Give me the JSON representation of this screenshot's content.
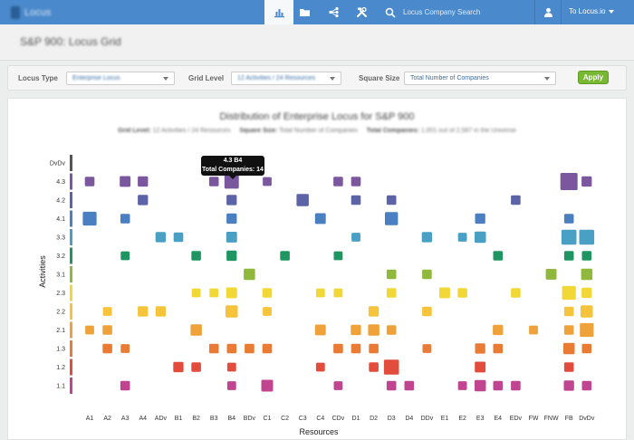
{
  "nav": {
    "logo_text": "Locus",
    "search_placeholder": "Locus Company Search",
    "user_link": "To Locus.io"
  },
  "page": {
    "title": "S&P 900: Locus Grid"
  },
  "controls": {
    "locus_type_label": "Locus Type",
    "locus_type_value": "Enterprise Locus",
    "grid_level_label": "Grid Level",
    "grid_level_value": "12 Activities / 24 Resources",
    "square_size_label": "Square Size",
    "square_size_value": "Total Number of Companies",
    "apply_label": "Apply"
  },
  "chart_header": {
    "title": "Distribution of Enterprise Locus for S&P 900",
    "subtitle_parts": [
      {
        "label": "Grid Level:",
        "value": "12 Activities / 24 Resources"
      },
      {
        "label": "Square Size:",
        "value": "Total Number of Companies"
      },
      {
        "label": "Total Companies:",
        "value": "1,001 out of 2,587 in the Universe"
      }
    ]
  },
  "tooltip": {
    "line1": "4.3 B4",
    "line2": "Total Companies: 14"
  },
  "chart_data": {
    "type": "scatter",
    "xlabel": "Resources",
    "ylabel": "Activities",
    "categories": [
      "A1",
      "A2",
      "A3",
      "A4",
      "ADv",
      "B1",
      "B2",
      "B3",
      "B4",
      "BDv",
      "C1",
      "C2",
      "C3",
      "C4",
      "CDv",
      "D1",
      "D2",
      "D3",
      "D4",
      "DDv",
      "E1",
      "E2",
      "E3",
      "E4",
      "EDv",
      "FW",
      "FNW",
      "FB",
      "DvDv"
    ],
    "rows": [
      {
        "label": "DvDv",
        "color": "#555555"
      },
      {
        "label": "4.3",
        "color": "#7b579e"
      },
      {
        "label": "4.2",
        "color": "#5c63a6"
      },
      {
        "label": "4.1",
        "color": "#4a7fc1"
      },
      {
        "label": "3.3",
        "color": "#4a9fc4"
      },
      {
        "label": "3.2",
        "color": "#1f9661"
      },
      {
        "label": "3.1",
        "color": "#8fb83c"
      },
      {
        "label": "2.3",
        "color": "#f2d836"
      },
      {
        "label": "2.2",
        "color": "#f5c43a"
      },
      {
        "label": "2.1",
        "color": "#f0a23a"
      },
      {
        "label": "1.3",
        "color": "#e97b35"
      },
      {
        "label": "1.2",
        "color": "#e34b3d"
      },
      {
        "label": "1.1",
        "color": "#c0448f"
      }
    ],
    "points": [
      {
        "row": "4.3",
        "col": "A1",
        "value": 3
      },
      {
        "row": "4.3",
        "col": "A3",
        "value": 5
      },
      {
        "row": "4.3",
        "col": "A4",
        "value": 4
      },
      {
        "row": "4.3",
        "col": "B3",
        "value": 3
      },
      {
        "row": "4.3",
        "col": "B4",
        "value": 14
      },
      {
        "row": "4.3",
        "col": "C1",
        "value": 2
      },
      {
        "row": "4.3",
        "col": "CDv",
        "value": 3
      },
      {
        "row": "4.3",
        "col": "D1",
        "value": 3
      },
      {
        "row": "4.3",
        "col": "FB",
        "value": 24
      },
      {
        "row": "4.3",
        "col": "DvDv",
        "value": 4
      },
      {
        "row": "4.2",
        "col": "A4",
        "value": 4
      },
      {
        "row": "4.2",
        "col": "B4",
        "value": 4
      },
      {
        "row": "4.2",
        "col": "C3",
        "value": 8
      },
      {
        "row": "4.2",
        "col": "D1",
        "value": 3
      },
      {
        "row": "4.2",
        "col": "D3",
        "value": 3
      },
      {
        "row": "4.2",
        "col": "EDv",
        "value": 3
      },
      {
        "row": "4.1",
        "col": "A1",
        "value": 12
      },
      {
        "row": "4.1",
        "col": "A3",
        "value": 3
      },
      {
        "row": "4.1",
        "col": "B4",
        "value": 4
      },
      {
        "row": "4.1",
        "col": "C4",
        "value": 5
      },
      {
        "row": "4.1",
        "col": "D3",
        "value": 10
      },
      {
        "row": "4.1",
        "col": "E3",
        "value": 4
      },
      {
        "row": "4.1",
        "col": "FB",
        "value": 3
      },
      {
        "row": "3.3",
        "col": "ADv",
        "value": 4
      },
      {
        "row": "3.3",
        "col": "B1",
        "value": 3
      },
      {
        "row": "3.3",
        "col": "B4",
        "value": 5
      },
      {
        "row": "3.3",
        "col": "D1",
        "value": 2
      },
      {
        "row": "3.3",
        "col": "DDv",
        "value": 4
      },
      {
        "row": "3.3",
        "col": "E2",
        "value": 2
      },
      {
        "row": "3.3",
        "col": "E3",
        "value": 6
      },
      {
        "row": "3.3",
        "col": "FB",
        "value": 16
      },
      {
        "row": "3.3",
        "col": "DvDv",
        "value": 16
      },
      {
        "row": "3.2",
        "col": "A3",
        "value": 2
      },
      {
        "row": "3.2",
        "col": "B2",
        "value": 3
      },
      {
        "row": "3.2",
        "col": "B4",
        "value": 4
      },
      {
        "row": "3.2",
        "col": "C2",
        "value": 3
      },
      {
        "row": "3.2",
        "col": "CDv",
        "value": 2
      },
      {
        "row": "3.2",
        "col": "E4",
        "value": 3
      },
      {
        "row": "3.2",
        "col": "FB",
        "value": 3
      },
      {
        "row": "3.2",
        "col": "DvDv",
        "value": 3
      },
      {
        "row": "3.1",
        "col": "BDv",
        "value": 6
      },
      {
        "row": "3.1",
        "col": "D3",
        "value": 3
      },
      {
        "row": "3.1",
        "col": "DDv",
        "value": 3
      },
      {
        "row": "3.1",
        "col": "FNW",
        "value": 5
      },
      {
        "row": "3.1",
        "col": "DvDv",
        "value": 6
      },
      {
        "row": "2.3",
        "col": "B2",
        "value": 2
      },
      {
        "row": "2.3",
        "col": "B3",
        "value": 2
      },
      {
        "row": "2.3",
        "col": "B4",
        "value": 5
      },
      {
        "row": "2.3",
        "col": "C1",
        "value": 3
      },
      {
        "row": "2.3",
        "col": "C4",
        "value": 2
      },
      {
        "row": "2.3",
        "col": "CDv",
        "value": 2
      },
      {
        "row": "2.3",
        "col": "D3",
        "value": 3
      },
      {
        "row": "2.3",
        "col": "E1",
        "value": 5
      },
      {
        "row": "2.3",
        "col": "E2",
        "value": 3
      },
      {
        "row": "2.3",
        "col": "EDv",
        "value": 3
      },
      {
        "row": "2.3",
        "col": "FB",
        "value": 12
      },
      {
        "row": "2.3",
        "col": "DvDv",
        "value": 4
      },
      {
        "row": "2.2",
        "col": "A2",
        "value": 2
      },
      {
        "row": "2.2",
        "col": "A4",
        "value": 4
      },
      {
        "row": "2.2",
        "col": "ADv",
        "value": 4
      },
      {
        "row": "2.2",
        "col": "B4",
        "value": 8
      },
      {
        "row": "2.2",
        "col": "C1",
        "value": 2
      },
      {
        "row": "2.2",
        "col": "D2",
        "value": 4
      },
      {
        "row": "2.2",
        "col": "DDv",
        "value": 3
      },
      {
        "row": "2.2",
        "col": "FB",
        "value": 3
      },
      {
        "row": "2.2",
        "col": "DvDv",
        "value": 8
      },
      {
        "row": "2.1",
        "col": "A1",
        "value": 2
      },
      {
        "row": "2.1",
        "col": "A2",
        "value": 3
      },
      {
        "row": "2.1",
        "col": "B2",
        "value": 6
      },
      {
        "row": "2.1",
        "col": "C4",
        "value": 5
      },
      {
        "row": "2.1",
        "col": "D1",
        "value": 4
      },
      {
        "row": "2.1",
        "col": "D2",
        "value": 6
      },
      {
        "row": "2.1",
        "col": "D3",
        "value": 3
      },
      {
        "row": "2.1",
        "col": "E4",
        "value": 4
      },
      {
        "row": "2.1",
        "col": "FW",
        "value": 2
      },
      {
        "row": "2.1",
        "col": "FB",
        "value": 3
      },
      {
        "row": "2.1",
        "col": "DvDv",
        "value": 12
      },
      {
        "row": "1.3",
        "col": "A2",
        "value": 3
      },
      {
        "row": "1.3",
        "col": "A3",
        "value": 2
      },
      {
        "row": "1.3",
        "col": "B3",
        "value": 3
      },
      {
        "row": "1.3",
        "col": "B4",
        "value": 3
      },
      {
        "row": "1.3",
        "col": "BDv",
        "value": 3
      },
      {
        "row": "1.3",
        "col": "C1",
        "value": 3
      },
      {
        "row": "1.3",
        "col": "CDv",
        "value": 3
      },
      {
        "row": "1.3",
        "col": "D1",
        "value": 3
      },
      {
        "row": "1.3",
        "col": "D2",
        "value": 3
      },
      {
        "row": "1.3",
        "col": "DDv",
        "value": 2
      },
      {
        "row": "1.3",
        "col": "E3",
        "value": 4
      },
      {
        "row": "1.3",
        "col": "E4",
        "value": 3
      },
      {
        "row": "1.3",
        "col": "FB",
        "value": 6
      },
      {
        "row": "1.3",
        "col": "DvDv",
        "value": 3
      },
      {
        "row": "1.2",
        "col": "B1",
        "value": 4
      },
      {
        "row": "1.2",
        "col": "B2",
        "value": 3
      },
      {
        "row": "1.2",
        "col": "B4",
        "value": 2
      },
      {
        "row": "1.2",
        "col": "C4",
        "value": 2
      },
      {
        "row": "1.2",
        "col": "D2",
        "value": 3
      },
      {
        "row": "1.2",
        "col": "D3",
        "value": 16
      },
      {
        "row": "1.2",
        "col": "E3",
        "value": 5
      },
      {
        "row": "1.2",
        "col": "FB",
        "value": 3
      },
      {
        "row": "1.1",
        "col": "A3",
        "value": 3
      },
      {
        "row": "1.1",
        "col": "B4",
        "value": 2
      },
      {
        "row": "1.1",
        "col": "C1",
        "value": 7
      },
      {
        "row": "1.1",
        "col": "CDv",
        "value": 2
      },
      {
        "row": "1.1",
        "col": "D3",
        "value": 3
      },
      {
        "row": "1.1",
        "col": "D4",
        "value": 3
      },
      {
        "row": "1.1",
        "col": "E2",
        "value": 2
      },
      {
        "row": "1.1",
        "col": "E3",
        "value": 6
      },
      {
        "row": "1.1",
        "col": "E4",
        "value": 3
      },
      {
        "row": "1.1",
        "col": "EDv",
        "value": 3
      },
      {
        "row": "1.1",
        "col": "FB",
        "value": 4
      },
      {
        "row": "1.1",
        "col": "DvDv",
        "value": 3
      }
    ]
  }
}
